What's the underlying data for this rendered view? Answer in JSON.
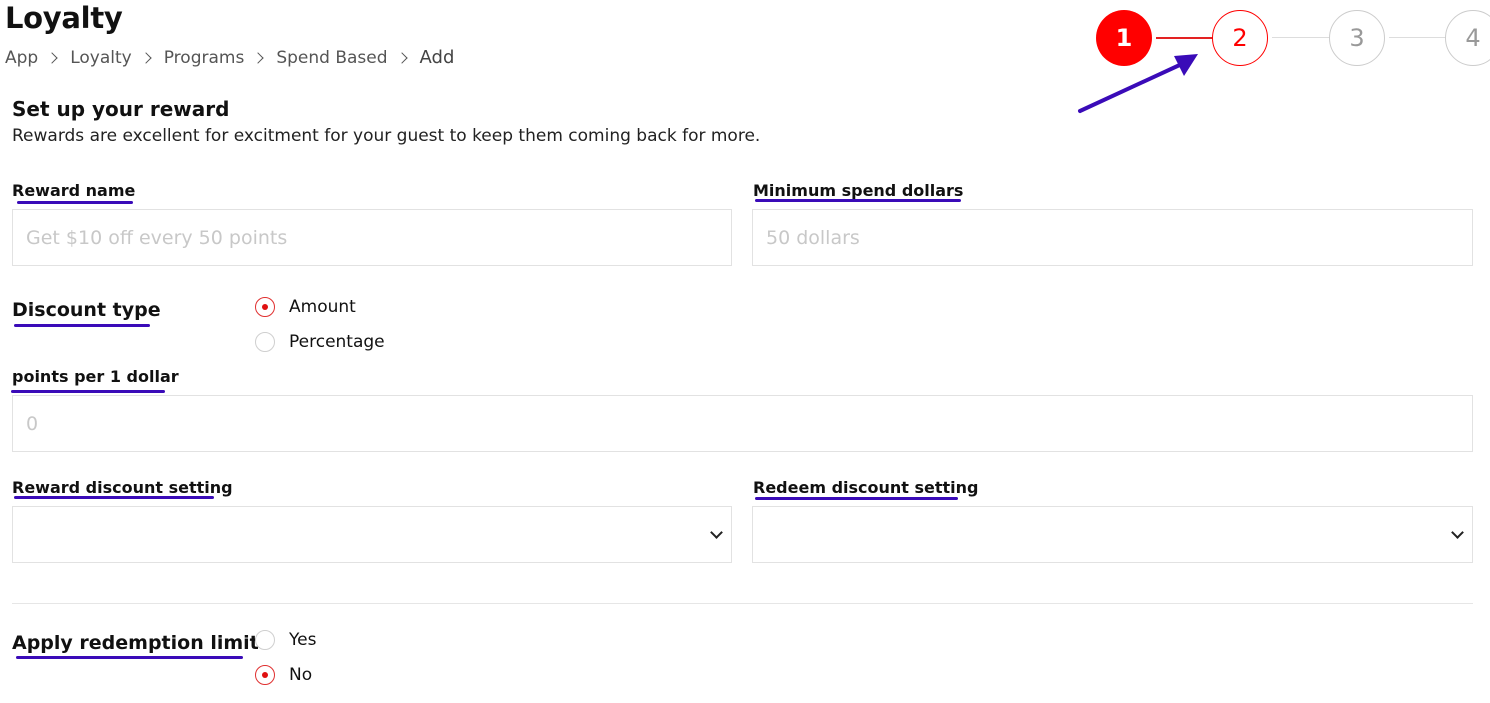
{
  "header": {
    "title": "Loyalty",
    "breadcrumb": [
      "App",
      "Loyalty",
      "Programs",
      "Spend Based",
      "Add"
    ]
  },
  "stepper": {
    "steps": [
      "1",
      "2",
      "3",
      "4"
    ],
    "current_step": 2
  },
  "section": {
    "title": "Set up your reward",
    "description": "Rewards are excellent for excitment for your guest to keep them coming back for more."
  },
  "form": {
    "reward_name": {
      "label": "Reward name",
      "placeholder": "Get $10 off every 50 points",
      "value": ""
    },
    "minimum_spend": {
      "label": "Minimum spend dollars",
      "placeholder": "50 dollars",
      "value": ""
    },
    "discount_type": {
      "label": "Discount type",
      "options": [
        "Amount",
        "Percentage"
      ],
      "selected": "Amount"
    },
    "points_per_dollar": {
      "label": "points per 1 dollar",
      "placeholder": "0",
      "value": ""
    },
    "reward_discount_setting": {
      "label": "Reward discount setting",
      "value": ""
    },
    "redeem_discount_setting": {
      "label": "Redeem discount setting",
      "value": ""
    },
    "apply_redemption_limit": {
      "label": "Apply redemption limit",
      "options": [
        "Yes",
        "No"
      ],
      "selected": "No"
    }
  },
  "colors": {
    "accent": "#ff0000",
    "annotation": "#3a0bb8",
    "border": "#e2e2e2"
  }
}
